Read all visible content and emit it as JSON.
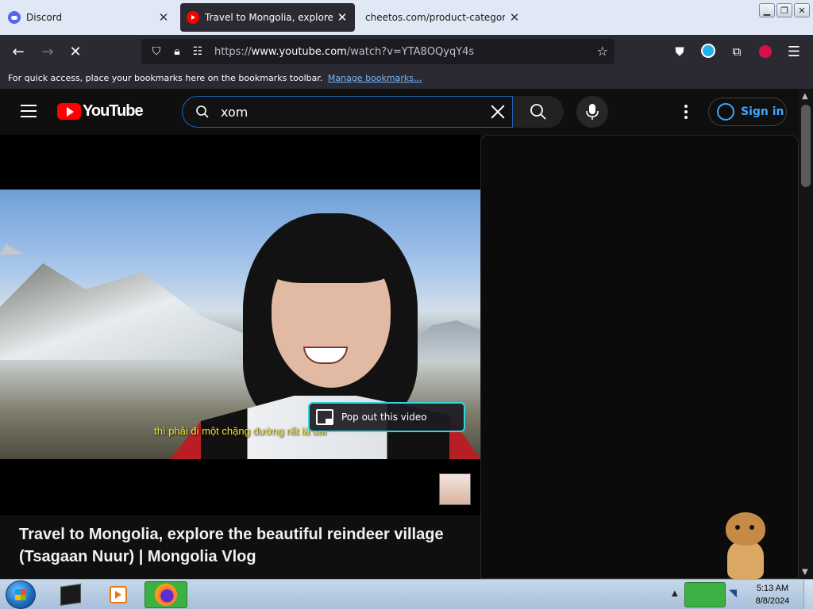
{
  "browser": {
    "tabs": [
      {
        "label": "Discord",
        "active": false,
        "icon": "discord-icon"
      },
      {
        "label": "Travel to Mongolia, explore the beautiful reindeer village (Tsagaan Nuur) | Mongolia Vlog",
        "active": true,
        "icon": "youtube-icon"
      },
      {
        "label": "cheetos.com/product-category/ma",
        "active": false,
        "icon": null
      }
    ],
    "url": {
      "scheme": "https://",
      "host": "www.youtube.com",
      "path": "/watch?v=YTA8OQyqY4s"
    },
    "bookmarks": {
      "hint": "For quick access, place your bookmarks here on the bookmarks toolbar.",
      "manage_link": "Manage bookmarks..."
    }
  },
  "youtube": {
    "logo_text": "YouTube",
    "search": {
      "query": "xom"
    },
    "signin_label": "Sign in",
    "video": {
      "subtitle": "thì phải đi một chặng đường rất là dài",
      "title": "Travel to Mongolia, explore the beautiful reindeer village (Tsagaan Nuur) | Mongolia Vlog"
    },
    "popout_label": "Pop out this video"
  },
  "taskbar": {
    "clock_time": "5:13 AM",
    "clock_date": "8/8/2024"
  },
  "colors": {
    "accent_blue": "#3ea6ff",
    "popout_border": "#32d5e0",
    "subtitle_yellow": "#f5e22a",
    "youtube_red": "#ff0000"
  }
}
